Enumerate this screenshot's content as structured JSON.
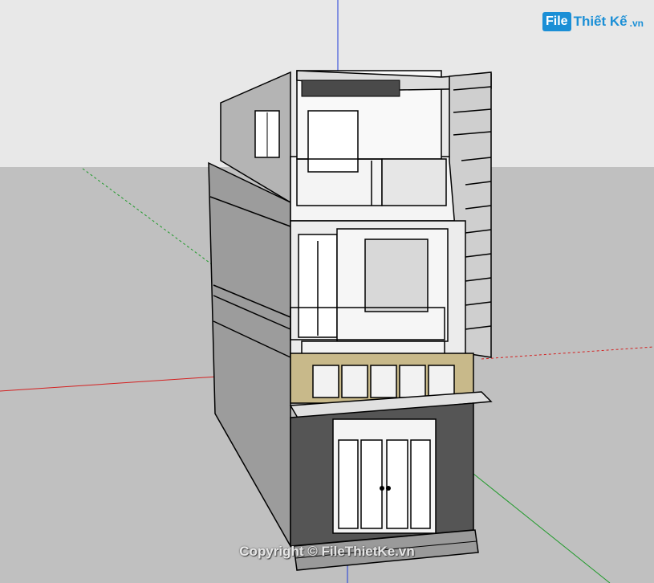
{
  "watermark": {
    "logo_box": "File",
    "logo_text": "Thiết Kế",
    "logo_tld": ".vn",
    "copyright": "Copyright © FileThietKe.vn"
  },
  "colors": {
    "sky": "#e8e8e8",
    "ground": "#c0c0c0",
    "wall_side": "#9c9c9c",
    "wall_front": "#f4f4f4",
    "ground_floor": "#555555",
    "axis_red": "#d42020",
    "axis_green": "#1f9a2a",
    "axis_blue": "#1e3ad8"
  }
}
